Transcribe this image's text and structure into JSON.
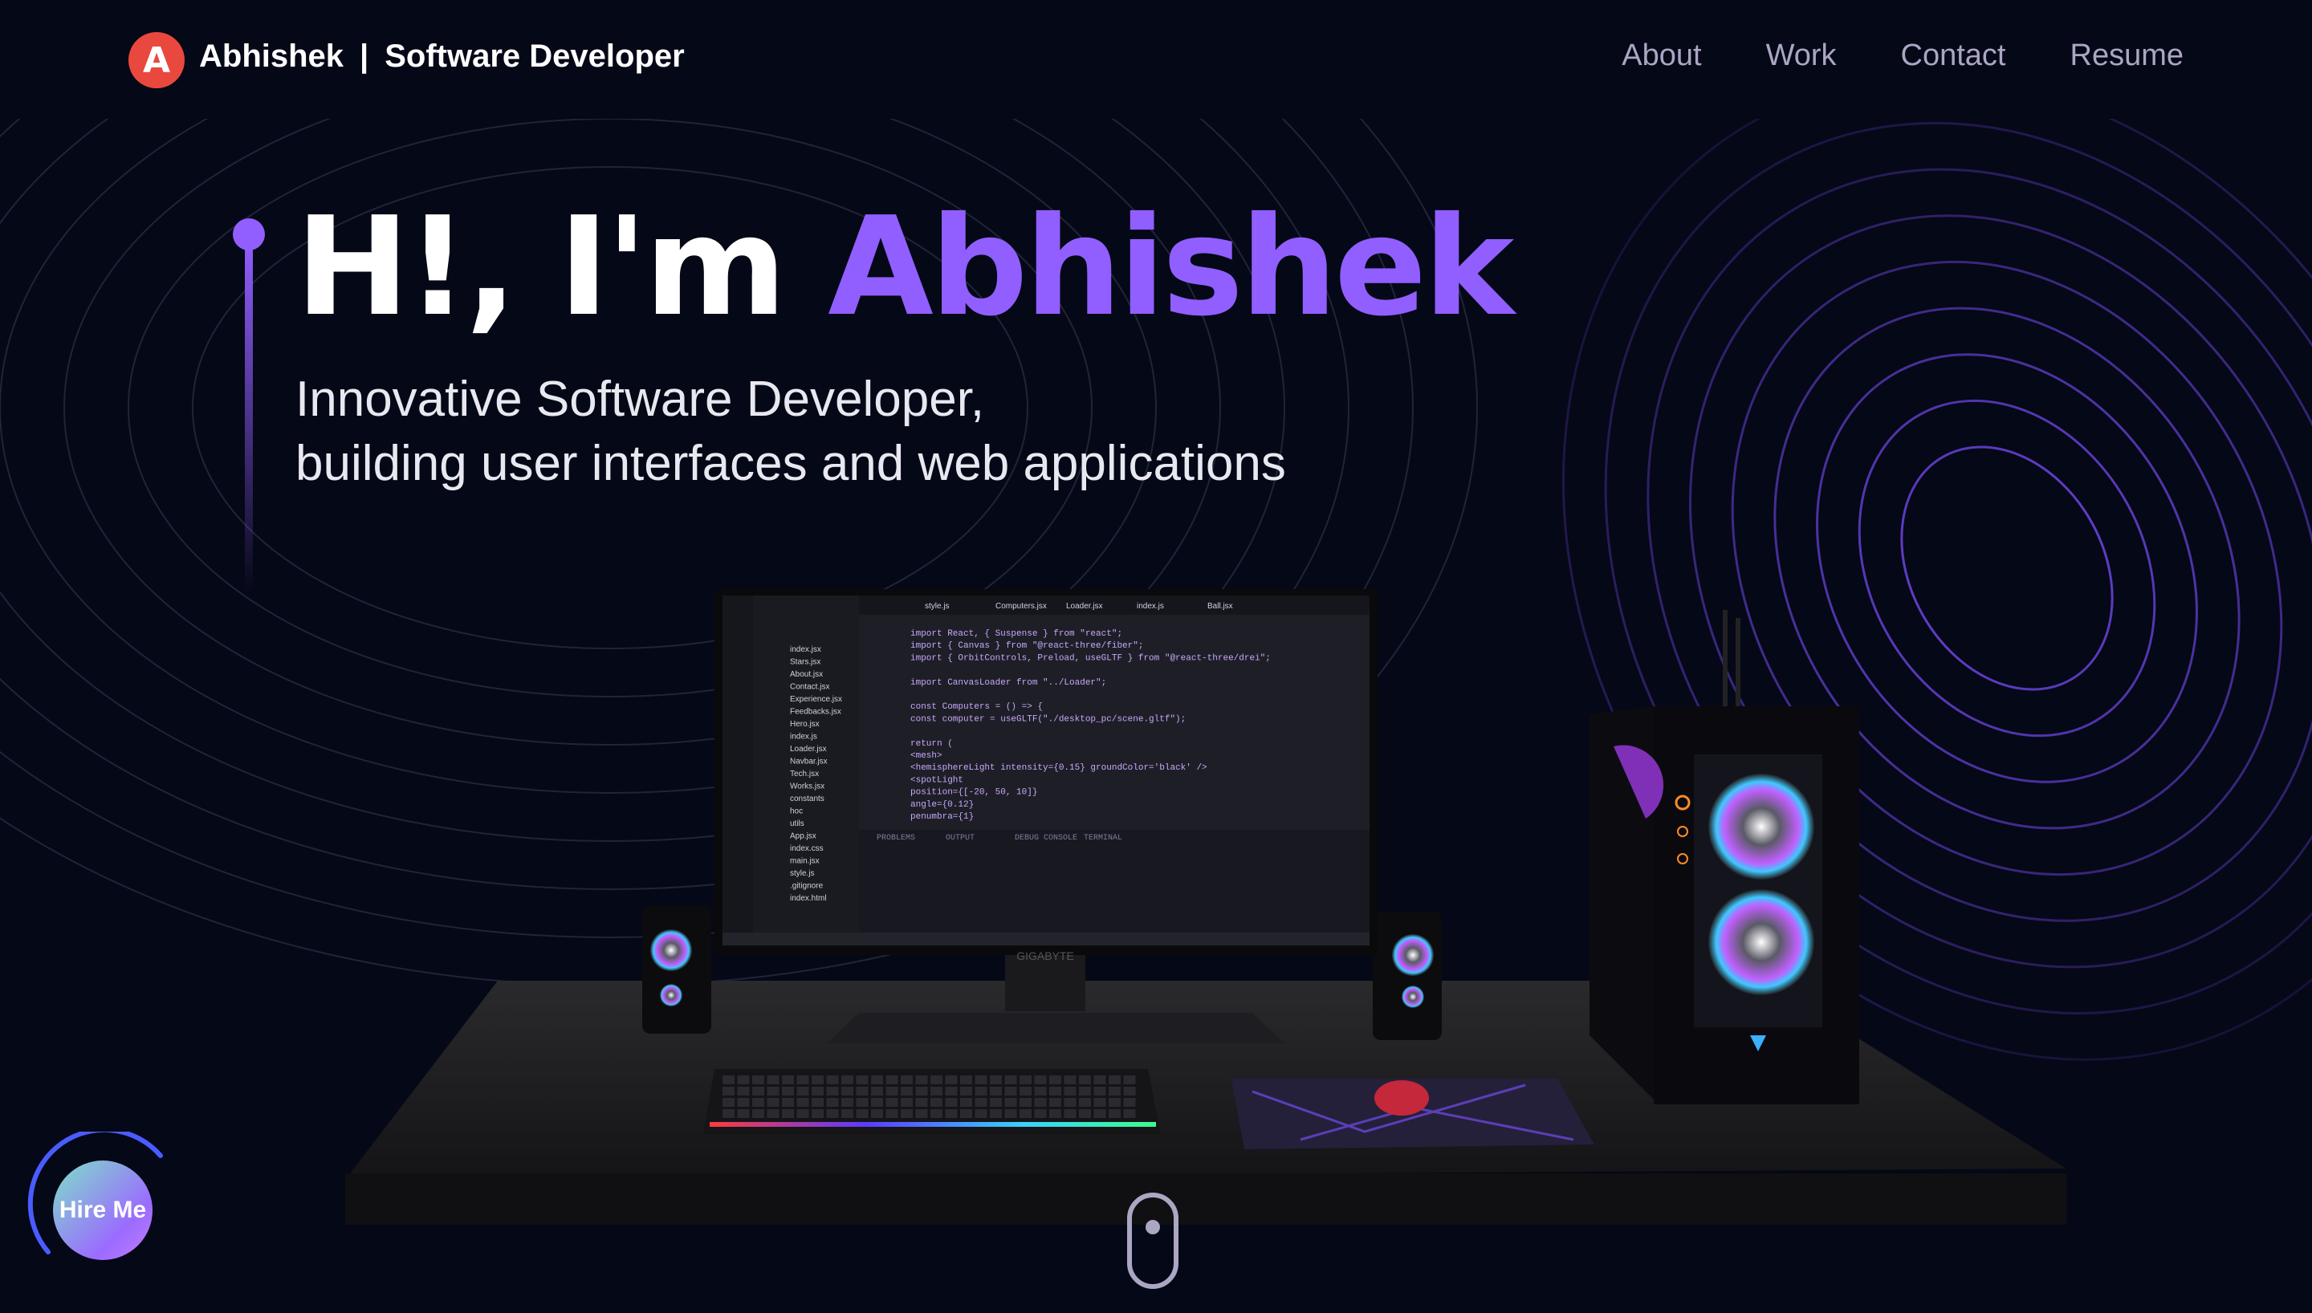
{
  "brand": {
    "initial": "A",
    "name": "Abhishek",
    "separator": "|",
    "role": "Software Developer"
  },
  "nav": {
    "links": [
      "About",
      "Work",
      "Contact",
      "Resume"
    ]
  },
  "hero": {
    "greeting": "H!, I'm ",
    "name": "Abhishek",
    "subtitle_line1": "Innovative Software Developer,",
    "subtitle_line2": "building user interfaces and web applications"
  },
  "hire_button": {
    "label": "Hire Me"
  },
  "monitor_brand": "GIGABYTE",
  "editor": {
    "tabs": [
      "style.js",
      "Computers.jsx",
      "Loader.jsx",
      "index.js",
      "Ball.jsx"
    ],
    "bottom_tabs": [
      "PROBLEMS",
      "OUTPUT",
      "DEBUG CONSOLE",
      "TERMINAL"
    ],
    "code": [
      "import React, { Suspense } from \"react\";",
      "import { Canvas } from \"@react-three/fiber\";",
      "import { OrbitControls, Preload, useGLTF } from \"@react-three/drei\";",
      "",
      "import CanvasLoader from \"../Loader\";",
      "",
      "const Computers = () => {",
      "  const computer = useGLTF(\"./desktop_pc/scene.gltf\");",
      "",
      "  return (",
      "    <mesh>",
      "      <hemisphereLight intensity={0.15} groundColor='black' />",
      "      <spotLight",
      "        position={[-20, 50, 10]}",
      "        angle={0.12}",
      "        penumbra={1}"
    ],
    "files": [
      "index.jsx",
      "Stars.jsx",
      "About.jsx",
      "Contact.jsx",
      "Experience.jsx",
      "Feedbacks.jsx",
      "Hero.jsx",
      "index.js",
      "Loader.jsx",
      "Navbar.jsx",
      "Tech.jsx",
      "Works.jsx",
      "constants",
      "hoc",
      "utils",
      "App.jsx",
      "index.css",
      "main.jsx",
      "style.js",
      ".gitignore",
      "index.html"
    ]
  }
}
